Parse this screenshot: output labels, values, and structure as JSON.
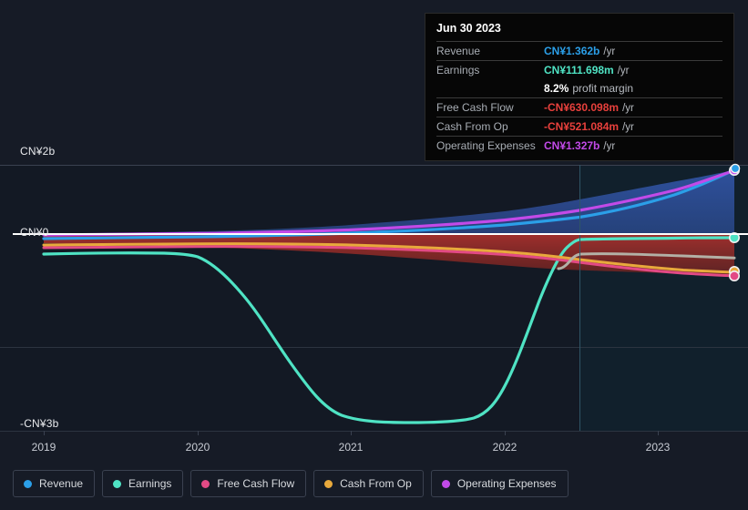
{
  "chart_data": {
    "type": "area",
    "title": "",
    "xlabel": "",
    "ylabel": "",
    "currency": "CN¥",
    "grid": true,
    "legend_position": "bottom",
    "y_ticks": [
      "CN¥2b",
      "CN¥0",
      "-CN¥3b"
    ],
    "y_tick_values": [
      2000000000,
      0,
      -3000000000
    ],
    "ylim": [
      -3000000000,
      2000000000
    ],
    "x_ticks": [
      "2019",
      "2020",
      "2021",
      "2022",
      "2023"
    ],
    "xlim": [
      "2018-09",
      "2023-12"
    ],
    "forecast_divider_x": "2022-09",
    "series": [
      {
        "name": "Revenue",
        "color": "#2b9fe8",
        "values_b": [
          0.02,
          0.03,
          0.04,
          0.05,
          0.06,
          0.07,
          0.09,
          0.12,
          0.18,
          0.26,
          0.4,
          0.62,
          0.9,
          1.2,
          1.362,
          1.6,
          1.9
        ],
        "end_value_label": "CN¥1.362b"
      },
      {
        "name": "Earnings",
        "color": "#4fe3c4",
        "values_b": [
          -0.18,
          -0.19,
          -0.21,
          -0.25,
          -0.45,
          -0.95,
          -1.7,
          -2.45,
          -2.82,
          -2.88,
          -2.85,
          -2.72,
          -1.9,
          -0.75,
          0.11,
          0.06,
          -0.02
        ],
        "end_value_label": "CN¥111.698m"
      },
      {
        "name": "Free Cash Flow",
        "color": "#e24a85",
        "values_b": [
          -0.09,
          -0.09,
          -0.1,
          -0.1,
          -0.11,
          -0.12,
          -0.14,
          -0.16,
          -0.19,
          -0.22,
          -0.25,
          -0.28,
          -0.32,
          -0.45,
          -0.63,
          -0.66,
          -0.7
        ],
        "end_value_label": "-CN¥630.098m"
      },
      {
        "name": "Cash From Op",
        "color": "#e8a93c",
        "values_b": [
          -0.07,
          -0.07,
          -0.08,
          -0.08,
          -0.09,
          -0.1,
          -0.11,
          -0.13,
          -0.15,
          -0.18,
          -0.21,
          -0.24,
          -0.28,
          -0.4,
          -0.521,
          -0.55,
          -0.58
        ],
        "end_value_label": "-CN¥521.084m"
      },
      {
        "name": "Operating Expenses",
        "color": "#c24ae8",
        "values_b": [
          0.06,
          0.07,
          0.08,
          0.09,
          0.11,
          0.13,
          0.16,
          0.2,
          0.26,
          0.34,
          0.46,
          0.63,
          0.88,
          1.12,
          1.327,
          1.58,
          1.84
        ],
        "end_value_label": "CN¥1.327b"
      },
      {
        "name": "Analyst Estimate",
        "color": "#b3b0a6",
        "values_b": [
          -0.42,
          -0.34,
          -0.31,
          -0.3,
          -0.3,
          -0.31
        ],
        "forecast": true
      }
    ]
  },
  "tooltip": {
    "date": "Jun 30 2023",
    "rows": [
      {
        "label": "Revenue",
        "value": "CN¥1.362b",
        "unit": "/yr",
        "color": "#2b9fe8"
      },
      {
        "label": "Earnings",
        "value": "CN¥111.698m",
        "unit": "/yr",
        "color": "#4fe3c4"
      },
      {
        "label": "",
        "value": "8.2%",
        "unit": "profit margin",
        "color": "#ffffff"
      },
      {
        "label": "Free Cash Flow",
        "value": "-CN¥630.098m",
        "unit": "/yr",
        "color": "#e8403c"
      },
      {
        "label": "Cash From Op",
        "value": "-CN¥521.084m",
        "unit": "/yr",
        "color": "#e8403c"
      },
      {
        "label": "Operating Expenses",
        "value": "CN¥1.327b",
        "unit": "/yr",
        "color": "#c24ae8"
      }
    ]
  },
  "axis": {
    "y": [
      {
        "label": "CN¥2b"
      },
      {
        "label": "CN¥0"
      },
      {
        "label": "-CN¥3b"
      }
    ],
    "x": [
      {
        "label": "2019"
      },
      {
        "label": "2020"
      },
      {
        "label": "2021"
      },
      {
        "label": "2022"
      },
      {
        "label": "2023"
      }
    ]
  },
  "legend": {
    "items": [
      {
        "label": "Revenue",
        "color": "#2b9fe8"
      },
      {
        "label": "Earnings",
        "color": "#4fe3c4"
      },
      {
        "label": "Free Cash Flow",
        "color": "#e24a85"
      },
      {
        "label": "Cash From Op",
        "color": "#e8a93c"
      },
      {
        "label": "Operating Expenses",
        "color": "#c24ae8"
      }
    ]
  }
}
